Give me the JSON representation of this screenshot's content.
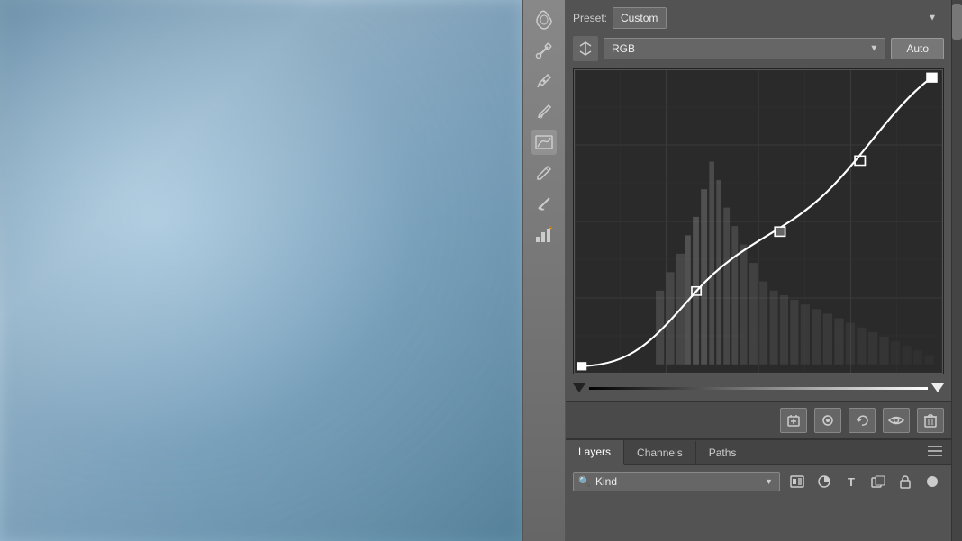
{
  "preset": {
    "label": "Preset:",
    "value": "Custom"
  },
  "channel": {
    "value": "RGB"
  },
  "buttons": {
    "auto": "Auto"
  },
  "layers_panel": {
    "tabs": [
      "Layers",
      "Channels",
      "Paths"
    ],
    "active_tab": "Layers",
    "filter_label": "Kind",
    "filter_placeholder": "Kind"
  },
  "toolbar": {
    "tools": [
      {
        "name": "hand-tool",
        "icon": "✥"
      },
      {
        "name": "eyedropper-tool",
        "icon": "💉"
      },
      {
        "name": "eyedropper2-tool",
        "icon": "🖊"
      },
      {
        "name": "eyedropper3-tool",
        "icon": "🖋"
      },
      {
        "name": "curves-tool",
        "icon": "〰"
      },
      {
        "name": "pencil-tool",
        "icon": "✏"
      },
      {
        "name": "slash-tool",
        "icon": "╱"
      },
      {
        "name": "histogram-tool",
        "icon": "⚠"
      }
    ]
  },
  "action_buttons": [
    {
      "name": "new-layer",
      "icon": "▣"
    },
    {
      "name": "mask",
      "icon": "⊙"
    },
    {
      "name": "undo",
      "icon": "↺"
    },
    {
      "name": "visibility",
      "icon": "👁"
    },
    {
      "name": "delete",
      "icon": "🗑"
    }
  ],
  "filter_icons": [
    {
      "name": "image-filter",
      "icon": "🖼"
    },
    {
      "name": "circle-filter",
      "icon": "◑"
    },
    {
      "name": "text-filter",
      "icon": "T"
    },
    {
      "name": "shape-filter",
      "icon": "⌐"
    },
    {
      "name": "lock-filter",
      "icon": "🔒"
    },
    {
      "name": "dot-filter",
      "icon": "●"
    }
  ],
  "colors": {
    "bg_panel": "#535353",
    "bg_dark": "#333333",
    "bg_toolbar": "#777777",
    "accent": "#ffffff",
    "border": "#222222"
  }
}
